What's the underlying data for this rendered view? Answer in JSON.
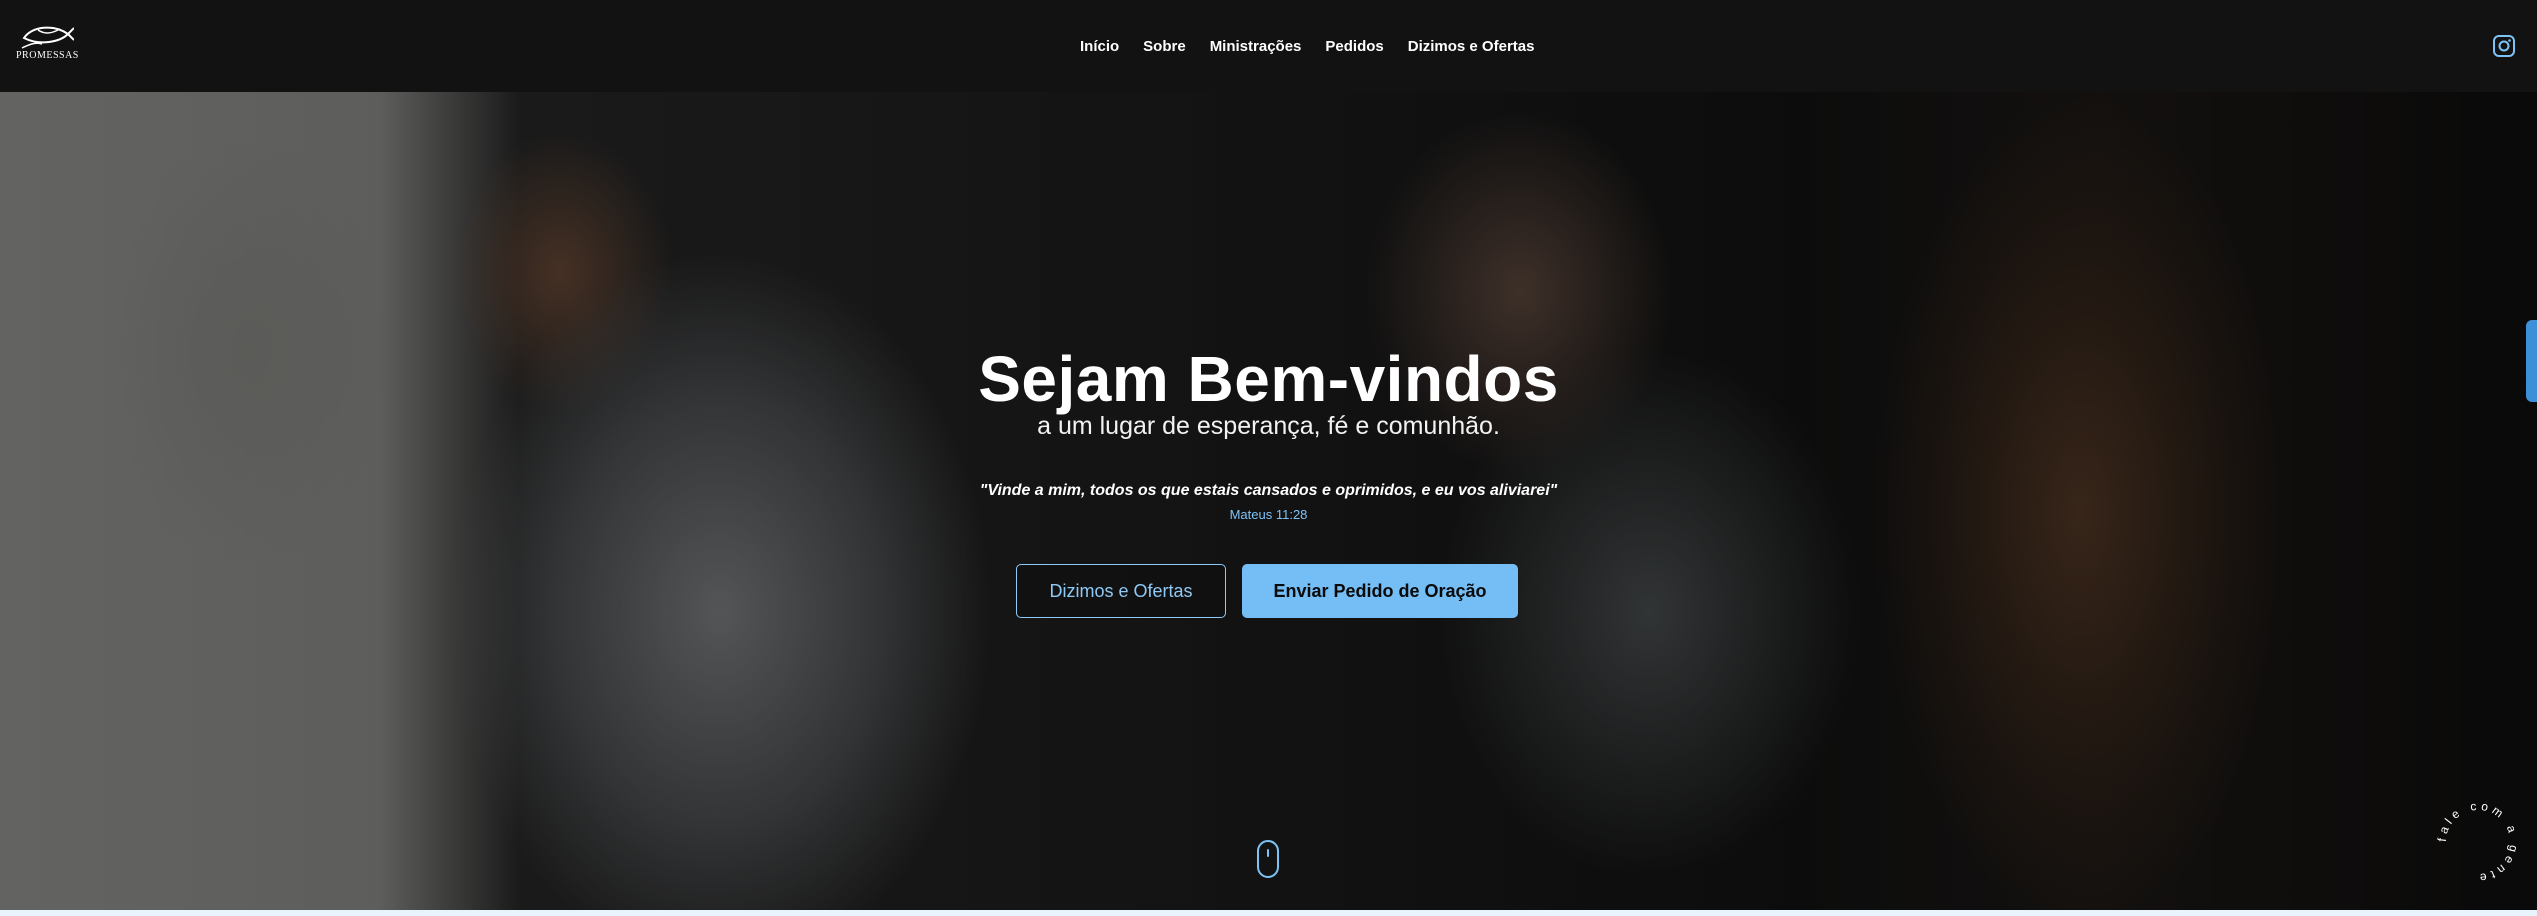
{
  "brand": {
    "logo_text": "PROMESSAS",
    "logo_icon": "fish-icon"
  },
  "nav": {
    "items": [
      {
        "label": "Início"
      },
      {
        "label": "Sobre"
      },
      {
        "label": "Ministrações"
      },
      {
        "label": "Pedidos"
      },
      {
        "label": "Dizimos e Ofertas"
      }
    ],
    "social_icon": "instagram-icon"
  },
  "hero": {
    "title": "Sejam Bem-vindos",
    "subtitle": "a um lugar de esperança, fé e comunhão.",
    "quote": "\"Vinde a mim, todos os que estais cansados e oprimidos, e eu vos aliviarei\"",
    "reference": "Mateus 11:28",
    "buttons": {
      "secondary": "Dizimos e Ofertas",
      "primary": "Enviar Pedido de Oração"
    },
    "scroll_icon": "mouse-scroll-icon"
  },
  "badge": {
    "circular_text": "fale com a gente"
  },
  "colors": {
    "accent": "#74bdf5",
    "accent_text": "#7ec3f5",
    "navbar_bg": "#121212"
  }
}
